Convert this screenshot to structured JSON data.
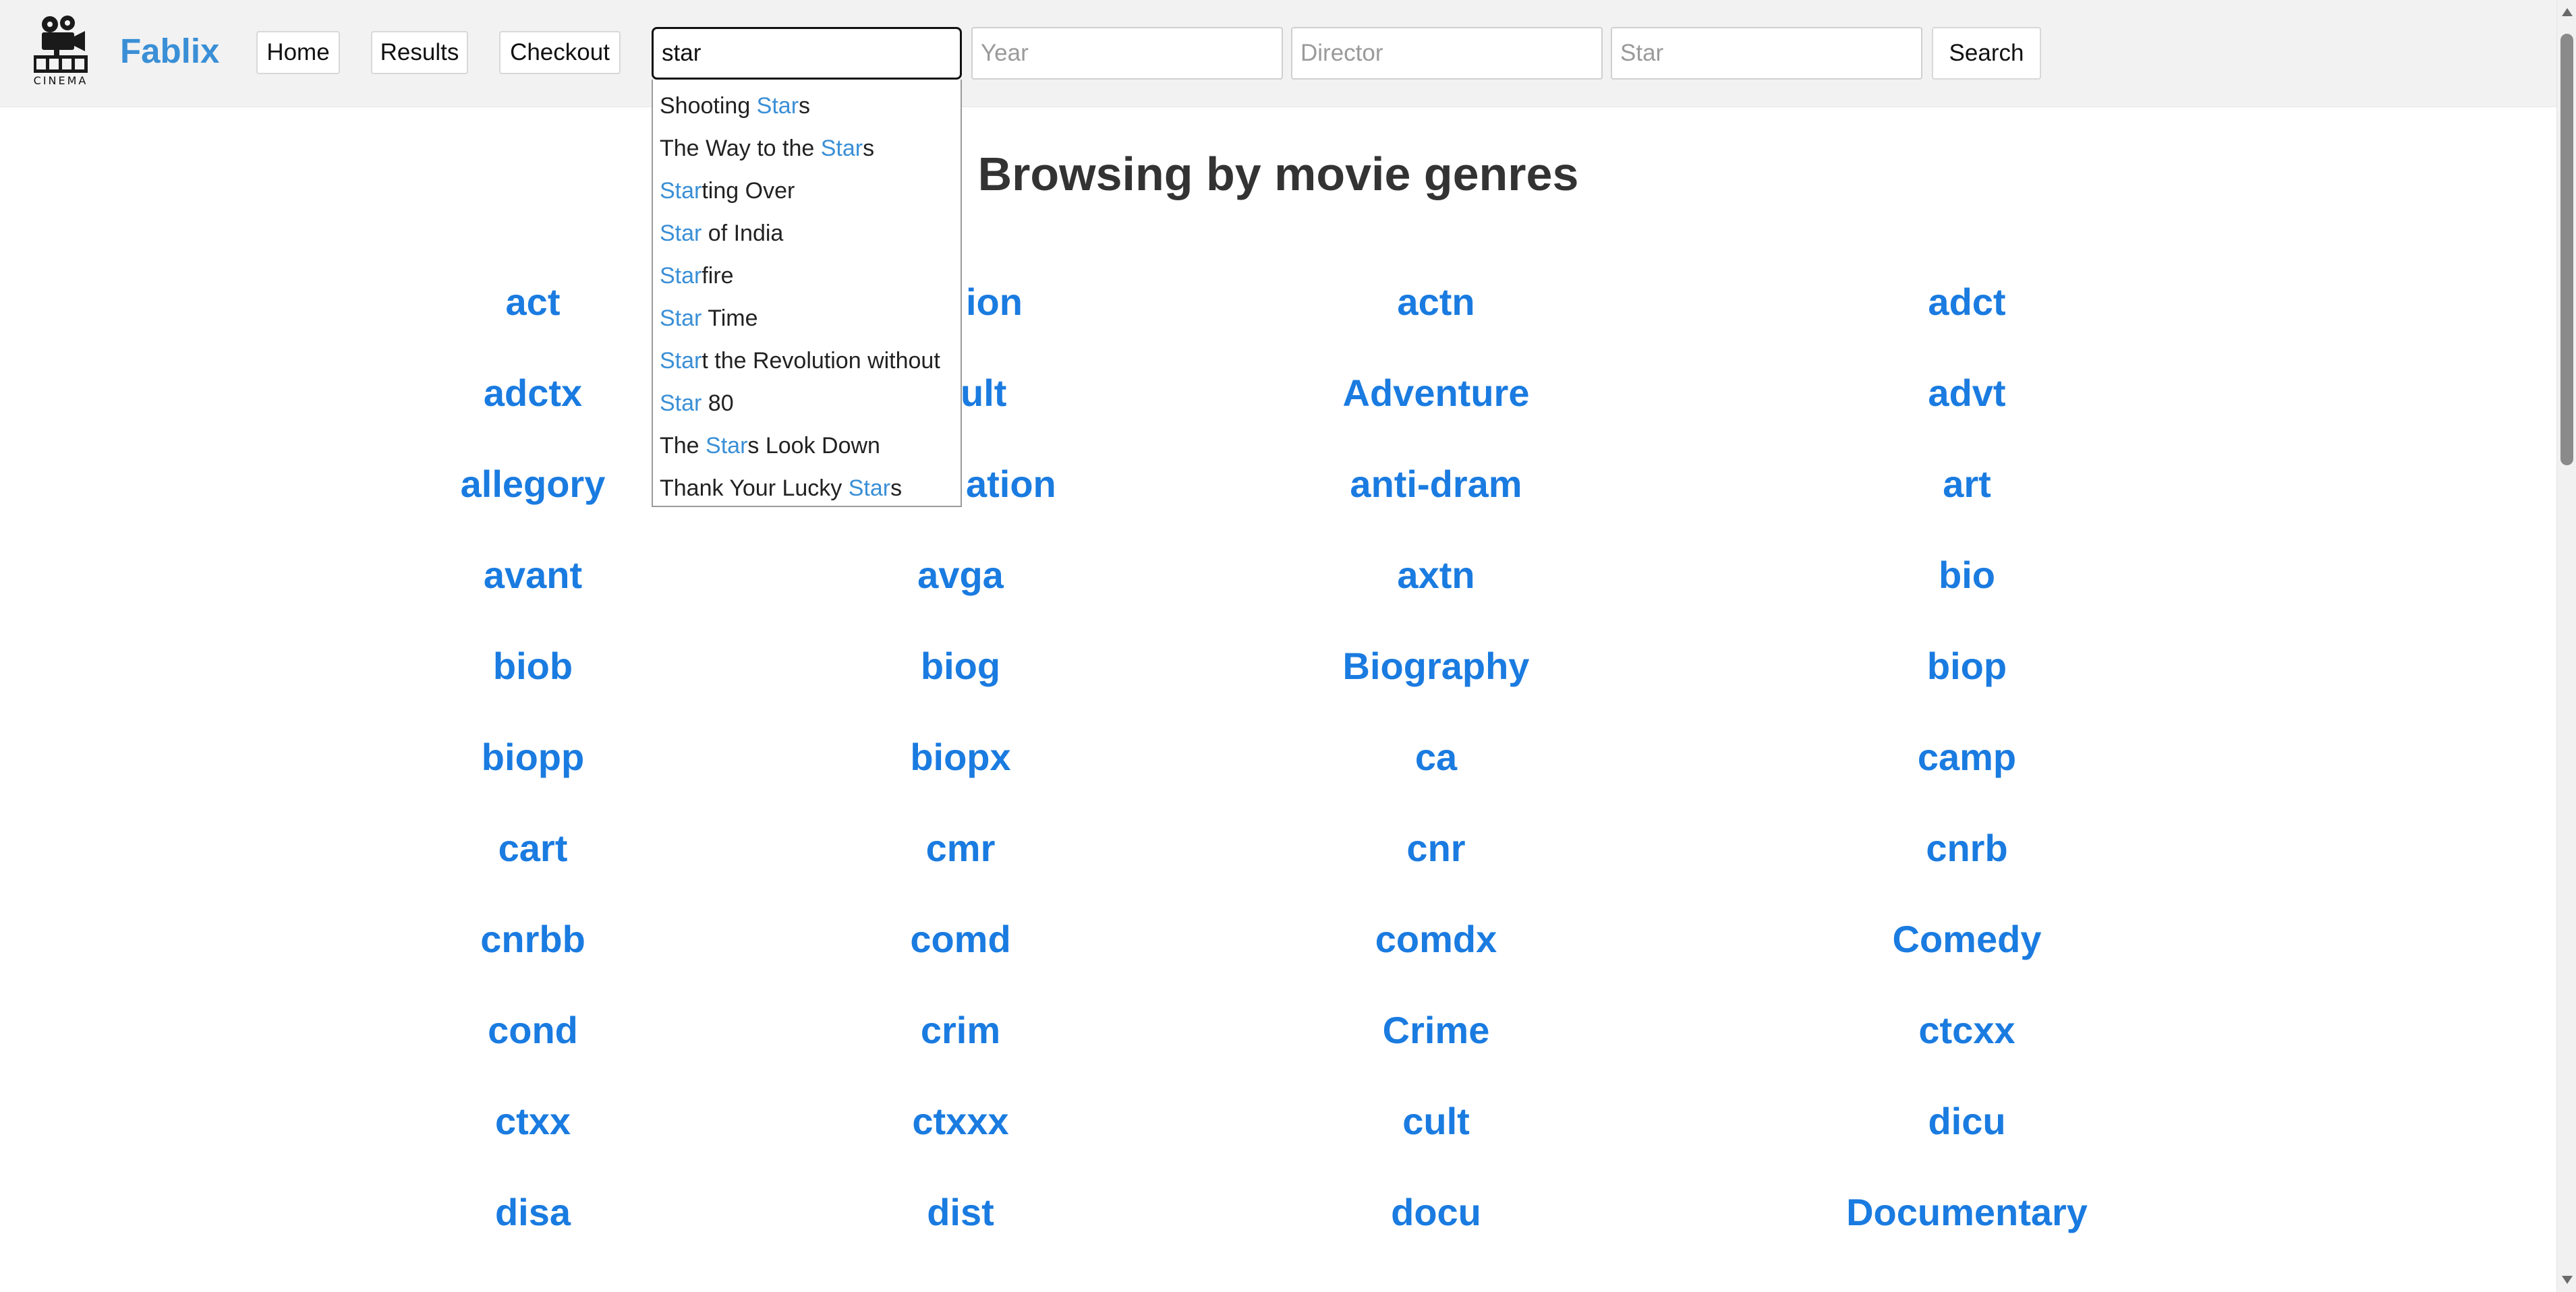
{
  "nav": {
    "logo_text": "CINEMA",
    "brand": "Fablix",
    "home": "Home",
    "results": "Results",
    "checkout": "Checkout"
  },
  "search": {
    "title_value": "star",
    "year_placeholder": "Year",
    "director_placeholder": "Director",
    "star_placeholder": "Star",
    "button": "Search"
  },
  "autocomplete": [
    {
      "pre": "Shooting ",
      "hl": "Star",
      "post": "s"
    },
    {
      "pre": "The Way to the ",
      "hl": "Star",
      "post": "s"
    },
    {
      "pre": "",
      "hl": "Star",
      "post": "ting Over"
    },
    {
      "pre": "",
      "hl": "Star",
      "post": " of India"
    },
    {
      "pre": "",
      "hl": "Star",
      "post": "fire"
    },
    {
      "pre": "",
      "hl": "Star",
      "post": " Time"
    },
    {
      "pre": "",
      "hl": "Star",
      "post": "t the Revolution without"
    },
    {
      "pre": "",
      "hl": "Star",
      "post": " 80"
    },
    {
      "pre": "The ",
      "hl": "Star",
      "post": "s Look Down"
    },
    {
      "pre": "Thank Your Lucky ",
      "hl": "Star",
      "post": "s"
    }
  ],
  "heading": "Browsing by movie genres",
  "genres": [
    "act",
    "",
    "actn",
    "adct",
    "adctx",
    "",
    "Adventure",
    "advt",
    "allegory",
    "",
    "anti-dram",
    "art",
    "avant",
    "avga",
    "axtn",
    "bio",
    "biob",
    "biog",
    "Biography",
    "biop",
    "biopp",
    "biopx",
    "ca",
    "camp",
    "cart",
    "cmr",
    "cnr",
    "cnrb",
    "cnrbb",
    "comd",
    "comdx",
    "Comedy",
    "cond",
    "crim",
    "Crime",
    "ctcxx",
    "ctxx",
    "ctxxx",
    "cult",
    "dicu",
    "disa",
    "dist",
    "docu",
    "Documentary"
  ],
  "partial_genres": [
    "ion",
    "ult",
    "ation"
  ]
}
